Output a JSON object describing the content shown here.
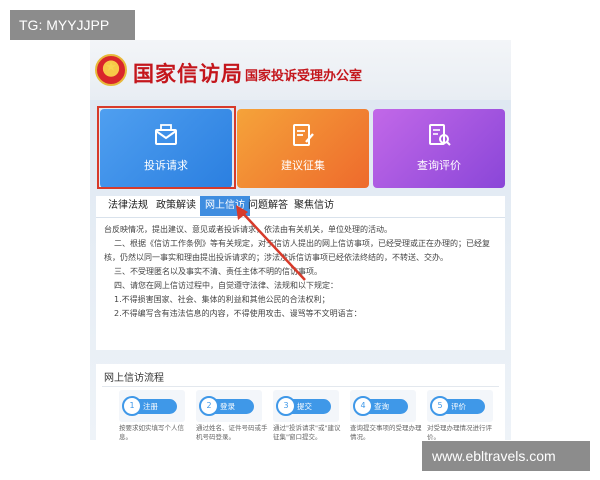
{
  "watermarks": {
    "top_tag": "TG: MYYJJPP",
    "bottom_url": "www.ebltravels.com"
  },
  "header": {
    "title": "国家信访局",
    "subtitle": "国家投诉受理办公室"
  },
  "tiles": [
    {
      "label": "投诉请求",
      "icon": "envelope-icon",
      "color": "#2b7fe0"
    },
    {
      "label": "建议征集",
      "icon": "edit-document-icon",
      "color": "#ee6a2c"
    },
    {
      "label": "查询评价",
      "icon": "search-document-icon",
      "color": "#8a46d8"
    }
  ],
  "nav": {
    "items": [
      "法律法规",
      "政策解读",
      "网上信访",
      "问题解答",
      "聚焦信访"
    ],
    "active": "网上信访"
  },
  "article": {
    "lines": [
      "台反映情况，提出建议、意见或者投诉请求，依法由有关机关，单位处理的活动。",
      "二、根据《信访工作条例》等有关规定，对于信访人提出的网上信访事项，已经受理或正在办理的；已经复",
      "核，仍然以同一事实和理由提出投诉请求的；涉法涉诉信访事项已经依法终结的，不转送、交办。",
      "三、不受理匿名以及事实不清、责任主体不明的信访事项。",
      "四、请您在网上信访过程中，自觉遵守法律、法规和以下规定：",
      "1.不得损害国家、社会、集体的利益和其他公民的合法权利；",
      "2.不得编写含有违法信息的内容，不得使用攻击、谩骂等不文明语言："
    ]
  },
  "process": {
    "title": "网上信访流程",
    "steps": [
      {
        "num": "1",
        "label": "注册",
        "desc": "按要求如实填写个人信息。"
      },
      {
        "num": "2",
        "label": "登录",
        "desc": "通过姓名、证件号码或手机号码登录。"
      },
      {
        "num": "3",
        "label": "提交",
        "desc": "通过\"投诉请求\"或\"建议征集\"窗口提交。"
      },
      {
        "num": "4",
        "label": "查询",
        "desc": "查询提交事项的受理办理情况。"
      },
      {
        "num": "5",
        "label": "评价",
        "desc": "对受理办理情况进行评价。"
      }
    ]
  },
  "colors": {
    "brand_red": "#c4161c",
    "highlight_box": "#d73a2a",
    "accent_blue": "#3f8de0"
  }
}
